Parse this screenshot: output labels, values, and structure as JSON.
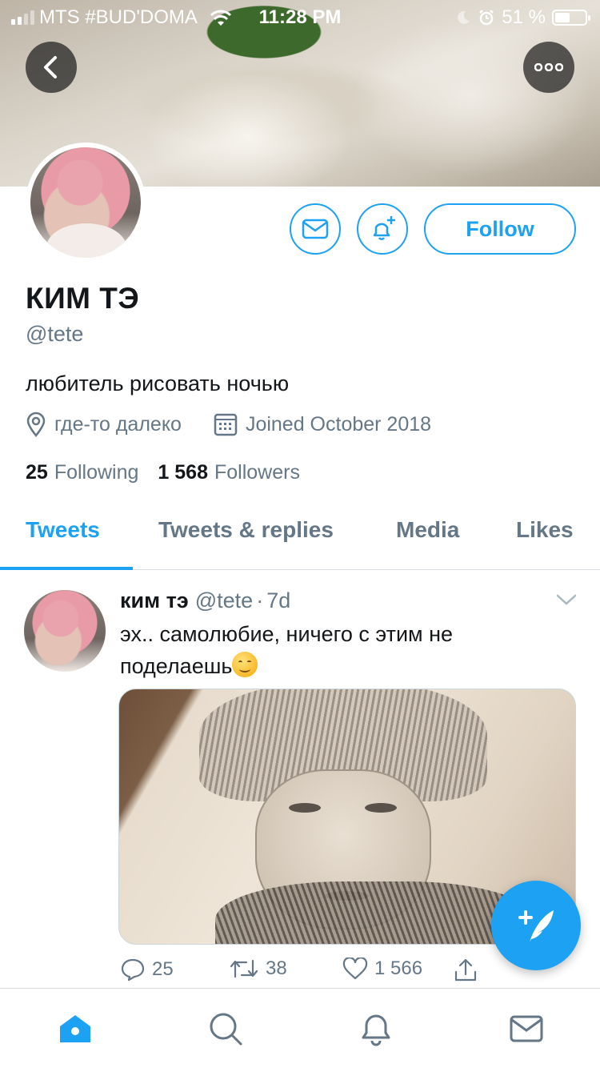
{
  "status_bar": {
    "carrier": "MTS #BUD'DOMA",
    "time": "11:28 PM",
    "battery_percent": "51 %",
    "battery_level": 0.51
  },
  "profile": {
    "display_name": "КИМ ТЭ",
    "handle": "@tete",
    "bio": "любитель рисовать ночью",
    "location": "где-то далеко",
    "joined": "Joined October 2018",
    "following_count": "25",
    "following_label": "Following",
    "followers_count": "1 568",
    "followers_label": "Followers",
    "follow_label": "Follow"
  },
  "tabs": [
    {
      "label": "Tweets",
      "active": true
    },
    {
      "label": "Tweets & replies",
      "active": false
    },
    {
      "label": "Media",
      "active": false
    },
    {
      "label": "Likes",
      "active": false
    }
  ],
  "tweet": {
    "author_name": "ким тэ",
    "author_handle": "@tete",
    "separator": "·",
    "time_ago": "7d",
    "text": "эх.. самолюбие, ничего с этим не поделаешь",
    "replies": "25",
    "retweets": "38",
    "likes": "1 566"
  },
  "colors": {
    "accent": "#1da1f2",
    "secondary_text": "#657786",
    "primary_text": "#14171a"
  },
  "icons": {
    "back": "chevron-left-icon",
    "more": "ellipsis-icon",
    "message": "envelope-icon",
    "notify": "bell-plus-icon",
    "location": "map-pin-icon",
    "calendar": "calendar-icon",
    "compose": "feather-plus-icon",
    "home": "home-icon",
    "search": "search-icon",
    "notifications": "bell-icon",
    "messages": "envelope-icon"
  }
}
